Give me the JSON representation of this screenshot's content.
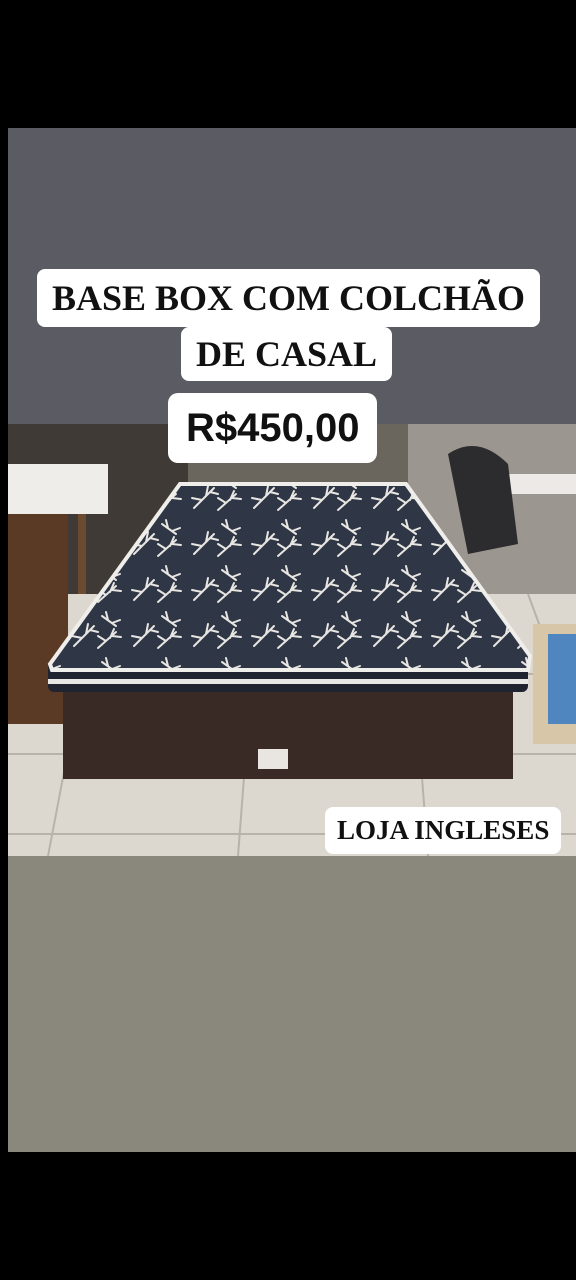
{
  "story": {
    "title_line1": "BASE BOX COM COLCHÃO",
    "title_line2": "DE CASAL",
    "price": "R$450,00",
    "store_label": "LOJA INGLESES"
  },
  "colors": {
    "top_band": "#5b5b64",
    "bottom_band": "#8a877d",
    "mattress": "#2f3645",
    "base_box": "#3a2a26"
  }
}
